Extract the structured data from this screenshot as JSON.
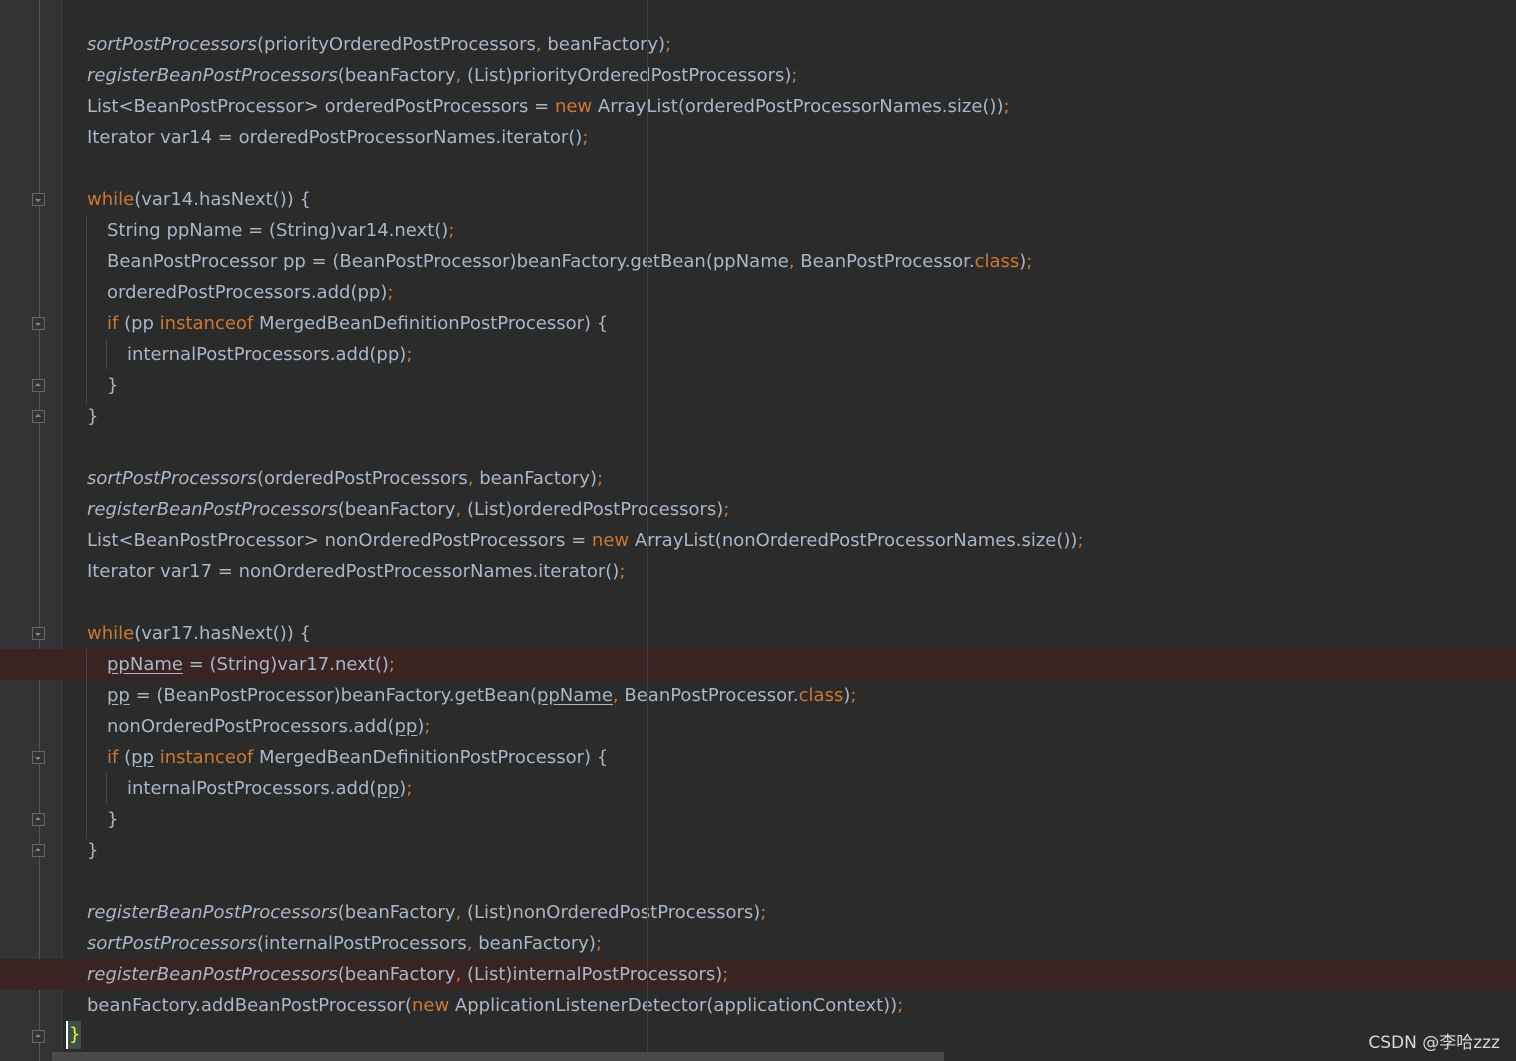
{
  "editor": {
    "theme": "darcula",
    "colors": {
      "background": "#2b2b2b",
      "gutter": "#313335",
      "text": "#a9b7c6",
      "keyword": "#cc7832",
      "breakpoint_line": "#3a2323",
      "breakpoint_icon": "#c75450"
    },
    "lines": [
      {
        "tokens": [
          [
            "italic",
            "sortPostProcessors"
          ],
          [
            "text",
            "(priorityOrderedPostProcessors"
          ],
          [
            "punct",
            ", "
          ],
          [
            "text",
            "beanFactory)"
          ],
          [
            "punct",
            ";"
          ]
        ]
      },
      {
        "tokens": [
          [
            "italic",
            "registerBeanPostProcessors"
          ],
          [
            "text",
            "(beanFactory"
          ],
          [
            "punct",
            ", "
          ],
          [
            "text",
            "(List)priorityOrderedPostProcessors)"
          ],
          [
            "punct",
            ";"
          ]
        ]
      },
      {
        "tokens": [
          [
            "text",
            "List<BeanPostProcessor> orderedPostProcessors = "
          ],
          [
            "keyword",
            "new "
          ],
          [
            "text",
            "ArrayList(orderedPostProcessorNames.size())"
          ],
          [
            "punct",
            ";"
          ]
        ]
      },
      {
        "tokens": [
          [
            "text",
            "Iterator var14 = orderedPostProcessorNames.iterator()"
          ],
          [
            "punct",
            ";"
          ]
        ]
      },
      {
        "tokens": []
      },
      {
        "tokens": [
          [
            "keyword",
            "while"
          ],
          [
            "text",
            "(var14.hasNext()) {"
          ]
        ]
      },
      {
        "tokens": [
          [
            "text",
            "String ppName = (String)var14.next()"
          ],
          [
            "punct",
            ";"
          ]
        ]
      },
      {
        "tokens": [
          [
            "text",
            "BeanPostProcessor pp = (BeanPostProcessor)beanFactory.getBean(ppName"
          ],
          [
            "punct",
            ", "
          ],
          [
            "text",
            "BeanPostProcessor."
          ],
          [
            "keyword",
            "class"
          ],
          [
            "text",
            ")"
          ],
          [
            "punct",
            ";"
          ]
        ]
      },
      {
        "tokens": [
          [
            "text",
            "orderedPostProcessors.add(pp)"
          ],
          [
            "punct",
            ";"
          ]
        ]
      },
      {
        "tokens": [
          [
            "keyword",
            "if "
          ],
          [
            "text",
            "(pp "
          ],
          [
            "keyword",
            "instanceof "
          ],
          [
            "text",
            "MergedBeanDefinitionPostProcessor) {"
          ]
        ]
      },
      {
        "tokens": [
          [
            "text",
            "internalPostProcessors.add(pp)"
          ],
          [
            "punct",
            ";"
          ]
        ]
      },
      {
        "tokens": [
          [
            "text",
            "}"
          ]
        ]
      },
      {
        "tokens": [
          [
            "text",
            "}"
          ]
        ]
      },
      {
        "tokens": []
      },
      {
        "tokens": [
          [
            "italic",
            "sortPostProcessors"
          ],
          [
            "text",
            "(orderedPostProcessors"
          ],
          [
            "punct",
            ", "
          ],
          [
            "text",
            "beanFactory)"
          ],
          [
            "punct",
            ";"
          ]
        ]
      },
      {
        "tokens": [
          [
            "italic",
            "registerBeanPostProcessors"
          ],
          [
            "text",
            "(beanFactory"
          ],
          [
            "punct",
            ", "
          ],
          [
            "text",
            "(List)orderedPostProcessors)"
          ],
          [
            "punct",
            ";"
          ]
        ]
      },
      {
        "tokens": [
          [
            "text",
            "List<BeanPostProcessor> nonOrderedPostProcessors = "
          ],
          [
            "keyword",
            "new "
          ],
          [
            "text",
            "ArrayList(nonOrderedPostProcessorNames.size())"
          ],
          [
            "punct",
            ";"
          ]
        ]
      },
      {
        "tokens": [
          [
            "text",
            "Iterator var17 = nonOrderedPostProcessorNames.iterator()"
          ],
          [
            "punct",
            ";"
          ]
        ]
      },
      {
        "tokens": []
      },
      {
        "tokens": [
          [
            "keyword",
            "while"
          ],
          [
            "text",
            "(var17.hasNext()) {"
          ]
        ]
      },
      {
        "tokens": [
          [
            "underline",
            "ppName"
          ],
          [
            "text",
            " = (String)var17.next()"
          ],
          [
            "punct",
            ";"
          ]
        ]
      },
      {
        "tokens": [
          [
            "underline",
            "pp"
          ],
          [
            "text",
            " = (BeanPostProcessor)beanFactory.getBean("
          ],
          [
            "underline",
            "ppName"
          ],
          [
            "punct",
            ", "
          ],
          [
            "text",
            "BeanPostProcessor."
          ],
          [
            "keyword",
            "class"
          ],
          [
            "text",
            ")"
          ],
          [
            "punct",
            ";"
          ]
        ]
      },
      {
        "tokens": [
          [
            "text",
            "nonOrderedPostProcessors.add("
          ],
          [
            "underline",
            "pp"
          ],
          [
            "text",
            ")"
          ],
          [
            "punct",
            ";"
          ]
        ]
      },
      {
        "tokens": [
          [
            "keyword",
            "if "
          ],
          [
            "text",
            "("
          ],
          [
            "underline",
            "pp"
          ],
          [
            "text",
            " "
          ],
          [
            "keyword",
            "instanceof "
          ],
          [
            "text",
            "MergedBeanDefinitionPostProcessor) {"
          ]
        ]
      },
      {
        "tokens": [
          [
            "text",
            "internalPostProcessors.add("
          ],
          [
            "underline",
            "pp"
          ],
          [
            "text",
            ")"
          ],
          [
            "punct",
            ";"
          ]
        ]
      },
      {
        "tokens": [
          [
            "text",
            "}"
          ]
        ]
      },
      {
        "tokens": [
          [
            "text",
            "}"
          ]
        ]
      },
      {
        "tokens": []
      },
      {
        "tokens": [
          [
            "italic",
            "registerBeanPostProcessors"
          ],
          [
            "text",
            "(beanFactory"
          ],
          [
            "punct",
            ", "
          ],
          [
            "text",
            "(List)nonOrderedPostProcessors)"
          ],
          [
            "punct",
            ";"
          ]
        ]
      },
      {
        "tokens": [
          [
            "italic",
            "sortPostProcessors"
          ],
          [
            "text",
            "(internalPostProcessors"
          ],
          [
            "punct",
            ", "
          ],
          [
            "text",
            "beanFactory)"
          ],
          [
            "punct",
            ";"
          ]
        ]
      },
      {
        "tokens": [
          [
            "italic",
            "registerBeanPostProcessors"
          ],
          [
            "text",
            "(beanFactory"
          ],
          [
            "punct",
            ", "
          ],
          [
            "text",
            "(List)internalPostProcessors)"
          ],
          [
            "punct",
            ";"
          ]
        ]
      },
      {
        "tokens": [
          [
            "text",
            "beanFactory.addBeanPostProcessor("
          ],
          [
            "keyword",
            "new "
          ],
          [
            "text",
            "ApplicationListenerDetector(applicationContext))"
          ],
          [
            "punct",
            ";"
          ]
        ]
      }
    ],
    "breakpoint_lines": [
      21,
      31
    ],
    "closing_brace": "}",
    "icons": [
      "fold-open-icon",
      "fold-close-icon",
      "breakpoint-icon"
    ]
  },
  "watermark": "CSDN @李哈zzz"
}
